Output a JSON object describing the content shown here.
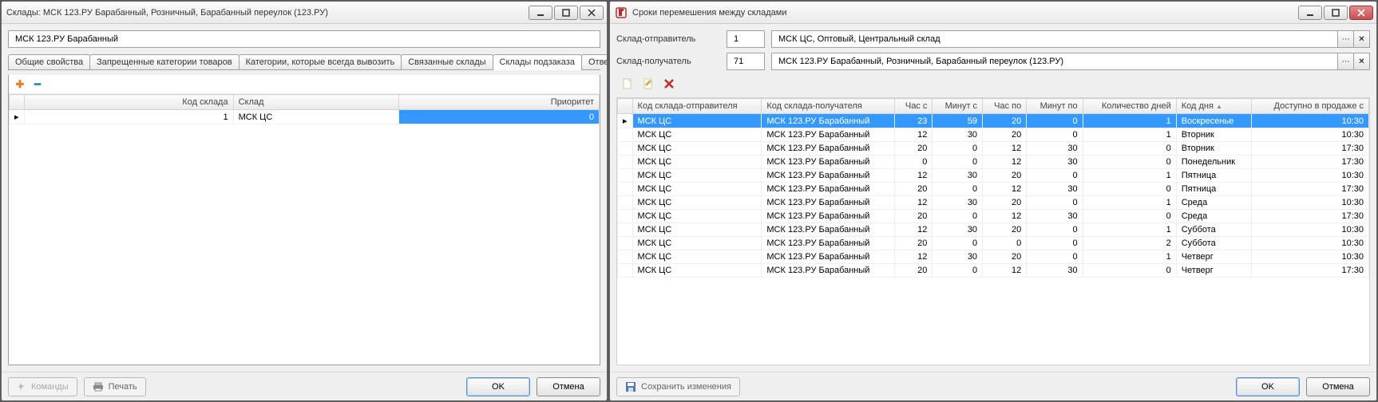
{
  "left": {
    "title": "Склады: МСК 123.РУ Барабанный, Розничный, Барабанный переулок (123.РУ)",
    "name_value": "МСК 123.РУ Барабанный",
    "tabs": [
      {
        "label": "Общие свойства"
      },
      {
        "label": "Запрещенные категории товаров"
      },
      {
        "label": "Категории, которые всегда вывозить"
      },
      {
        "label": "Связанные склады"
      },
      {
        "label": "Склады подзаказа"
      },
      {
        "label": "Ответствен"
      }
    ],
    "active_tab_index": 4,
    "grid": {
      "columns": [
        "Код склада",
        "Склад",
        "Приоритет"
      ],
      "rows": [
        {
          "code": "1",
          "name": "МСК ЦС",
          "priority": "0"
        }
      ]
    },
    "cmd_label": "Команды",
    "print_label": "Печать",
    "ok_label": "OK",
    "cancel_label": "Отмена"
  },
  "right": {
    "title": "Сроки перемешения между складами",
    "sender_label": "Склад-отправитель",
    "receiver_label": "Склад-получатель",
    "sender_code": "1",
    "sender_name": "МСК ЦС, Оптовый, Центральный склад",
    "receiver_code": "71",
    "receiver_name": "МСК 123.РУ Барабанный, Розничный, Барабанный переулок (123.РУ)",
    "grid": {
      "columns": [
        "Код склада-отправителя",
        "Код склада-получателя",
        "Час с",
        "Минут с",
        "Час по",
        "Минут по",
        "Количество дней",
        "Код дня",
        "Доступно в продаже с"
      ],
      "rows": [
        {
          "from": "МСК ЦС",
          "to": "МСК 123.РУ Барабанный",
          "hc": "23",
          "mc": "59",
          "hpo": "20",
          "mpo": "0",
          "days": "1",
          "day": "Воскресенье",
          "avail": "10:30",
          "sel": true
        },
        {
          "from": "МСК ЦС",
          "to": "МСК 123.РУ Барабанный",
          "hc": "12",
          "mc": "30",
          "hpo": "20",
          "mpo": "0",
          "days": "1",
          "day": "Вторник",
          "avail": "10:30"
        },
        {
          "from": "МСК ЦС",
          "to": "МСК 123.РУ Барабанный",
          "hc": "20",
          "mc": "0",
          "hpo": "12",
          "mpo": "30",
          "days": "0",
          "day": "Вторник",
          "avail": "17:30"
        },
        {
          "from": "МСК ЦС",
          "to": "МСК 123.РУ Барабанный",
          "hc": "0",
          "mc": "0",
          "hpo": "12",
          "mpo": "30",
          "days": "0",
          "day": "Понедельник",
          "avail": "17:30"
        },
        {
          "from": "МСК ЦС",
          "to": "МСК 123.РУ Барабанный",
          "hc": "12",
          "mc": "30",
          "hpo": "20",
          "mpo": "0",
          "days": "1",
          "day": "Пятница",
          "avail": "10:30"
        },
        {
          "from": "МСК ЦС",
          "to": "МСК 123.РУ Барабанный",
          "hc": "20",
          "mc": "0",
          "hpo": "12",
          "mpo": "30",
          "days": "0",
          "day": "Пятница",
          "avail": "17:30"
        },
        {
          "from": "МСК ЦС",
          "to": "МСК 123.РУ Барабанный",
          "hc": "12",
          "mc": "30",
          "hpo": "20",
          "mpo": "0",
          "days": "1",
          "day": "Среда",
          "avail": "10:30"
        },
        {
          "from": "МСК ЦС",
          "to": "МСК 123.РУ Барабанный",
          "hc": "20",
          "mc": "0",
          "hpo": "12",
          "mpo": "30",
          "days": "0",
          "day": "Среда",
          "avail": "17:30"
        },
        {
          "from": "МСК ЦС",
          "to": "МСК 123.РУ Барабанный",
          "hc": "12",
          "mc": "30",
          "hpo": "20",
          "mpo": "0",
          "days": "1",
          "day": "Суббота",
          "avail": "10:30"
        },
        {
          "from": "МСК ЦС",
          "to": "МСК 123.РУ Барабанный",
          "hc": "20",
          "mc": "0",
          "hpo": "0",
          "mpo": "0",
          "days": "2",
          "day": "Суббота",
          "avail": "10:30"
        },
        {
          "from": "МСК ЦС",
          "to": "МСК 123.РУ Барабанный",
          "hc": "12",
          "mc": "30",
          "hpo": "20",
          "mpo": "0",
          "days": "1",
          "day": "Четверг",
          "avail": "10:30"
        },
        {
          "from": "МСК ЦС",
          "to": "МСК 123.РУ Барабанный",
          "hc": "20",
          "mc": "0",
          "hpo": "12",
          "mpo": "30",
          "days": "0",
          "day": "Четверг",
          "avail": "17:30"
        }
      ]
    },
    "save_label": "Сохранить изменения",
    "ok_label": "OK",
    "cancel_label": "Отмена"
  }
}
